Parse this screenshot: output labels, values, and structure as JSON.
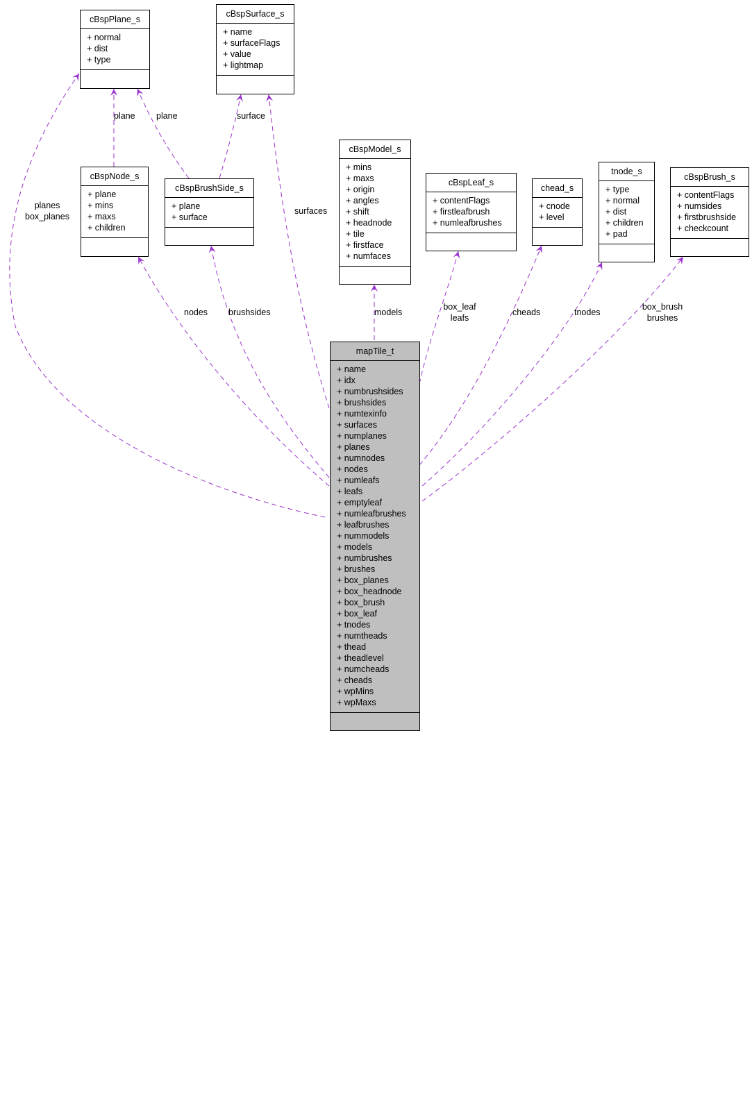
{
  "diagram": {
    "main_class": {
      "name": "mapTile_t",
      "members": [
        "+ name",
        "+ idx",
        "+ numbrushsides",
        "+ brushsides",
        "+ numtexinfo",
        "+ surfaces",
        "+ numplanes",
        "+ planes",
        "+ numnodes",
        "+ nodes",
        "+ numleafs",
        "+ leafs",
        "+ emptyleaf",
        "+ numleafbrushes",
        "+ leafbrushes",
        "+ nummodels",
        "+ models",
        "+ numbrushes",
        "+ brushes",
        "+ box_planes",
        "+ box_headnode",
        "+ box_brush",
        "+ box_leaf",
        "+ tnodes",
        "+ numtheads",
        "+ thead",
        "+ theadlevel",
        "+ numcheads",
        "+ cheads",
        "+ wpMins",
        "+ wpMaxs"
      ]
    },
    "classes": {
      "plane": {
        "name": "cBspPlane_s",
        "members": [
          "+ normal",
          "+ dist",
          "+ type"
        ]
      },
      "surface": {
        "name": "cBspSurface_s",
        "members": [
          "+ name",
          "+ surfaceFlags",
          "+ value",
          "+ lightmap"
        ]
      },
      "node": {
        "name": "cBspNode_s",
        "members": [
          "+ plane",
          "+ mins",
          "+ maxs",
          "+ children"
        ]
      },
      "brushside": {
        "name": "cBspBrushSide_s",
        "members": [
          "+ plane",
          "+ surface"
        ]
      },
      "model": {
        "name": "cBspModel_s",
        "members": [
          "+ mins",
          "+ maxs",
          "+ origin",
          "+ angles",
          "+ shift",
          "+ headnode",
          "+ tile",
          "+ firstface",
          "+ numfaces"
        ]
      },
      "leaf": {
        "name": "cBspLeaf_s",
        "members": [
          "+ contentFlags",
          "+ firstleafbrush",
          "+ numleafbrushes"
        ]
      },
      "chead": {
        "name": "chead_s",
        "members": [
          "+ cnode",
          "+ level"
        ]
      },
      "tnode": {
        "name": "tnode_s",
        "members": [
          "+ type",
          "+ normal",
          "+ dist",
          "+ children",
          "+ pad"
        ]
      },
      "brush": {
        "name": "cBspBrush_s",
        "members": [
          "+ contentFlags",
          "+ numsides",
          "+ firstbrushside",
          "+ checkcount"
        ]
      }
    },
    "edge_labels": {
      "planes": [
        "planes",
        "box_planes"
      ],
      "node_plane": [
        "plane"
      ],
      "brushside_plane": [
        "plane"
      ],
      "brushside_surface": [
        "surface"
      ],
      "surfaces": [
        "surfaces"
      ],
      "nodes": [
        "nodes"
      ],
      "brushsides": [
        "brushsides"
      ],
      "models": [
        "models"
      ],
      "leafs": [
        "box_leaf",
        "leafs"
      ],
      "cheads": [
        "cheads"
      ],
      "tnodes": [
        "tnodes"
      ],
      "brushes": [
        "box_brush",
        "brushes"
      ]
    },
    "colors": {
      "edge": "#9a32cd",
      "main_fill": "#bfbfbf"
    }
  }
}
